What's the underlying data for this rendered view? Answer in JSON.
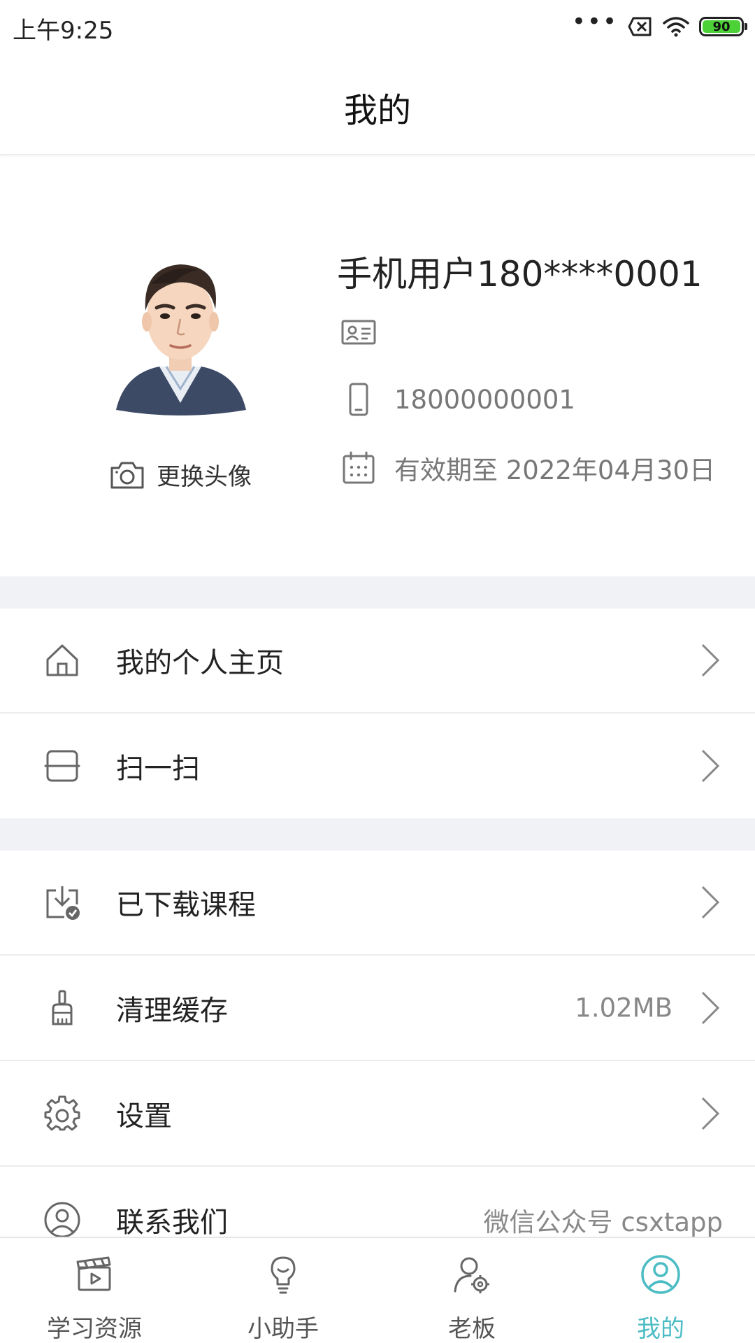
{
  "status_bar": {
    "time": "上午9:25",
    "dots": "•••",
    "battery": "90"
  },
  "header": {
    "title": "我的"
  },
  "profile": {
    "name": "手机用户180****0001",
    "phone": "18000000001",
    "validity": "有效期至 2022年04月30日",
    "change_avatar": "更换头像"
  },
  "menu": {
    "homepage": {
      "label": "我的个人主页"
    },
    "scan": {
      "label": "扫一扫"
    },
    "downloads": {
      "label": "已下载课程"
    },
    "cache": {
      "label": "清理缓存",
      "value": "1.02MB"
    },
    "settings": {
      "label": "设置"
    },
    "contact": {
      "label": "联系我们",
      "value": "微信公众号 csxtapp"
    }
  },
  "nav": {
    "items": [
      {
        "label": "学习资源",
        "icon": "clapperboard-icon"
      },
      {
        "label": "小助手",
        "icon": "lightbulb-icon"
      },
      {
        "label": "老板",
        "icon": "user-gear-icon"
      },
      {
        "label": "我的",
        "icon": "user-circle-icon"
      }
    ],
    "active_color": "#4bbcc4"
  },
  "colors": {
    "accent": "#4bbcc4",
    "separator": "#f1f2f6",
    "battery": "#4cd137"
  }
}
